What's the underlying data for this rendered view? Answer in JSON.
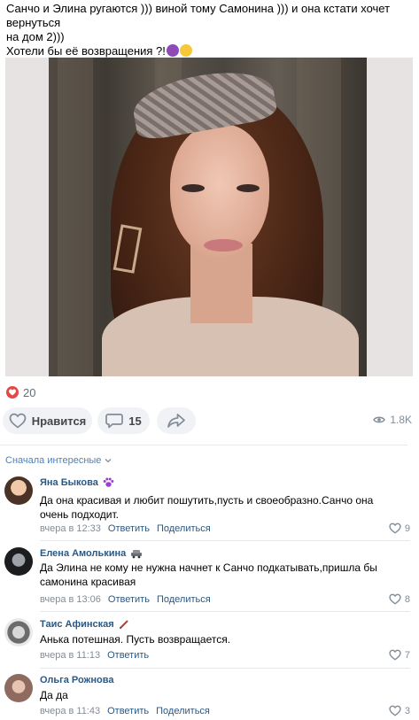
{
  "post": {
    "line1": "Санчо и Элина ругаются ))) виной тому Самонина ))) и она кстати хочет вернуться",
    "line2": "на дом 2)))",
    "line3": "Хотели бы её возвращения ?!",
    "emoji": [
      "purple-face-emoji",
      "yellow-face-emoji"
    ]
  },
  "reactions": {
    "likes": "20",
    "heart_color": "#e64646"
  },
  "actions": {
    "like_label": "Нравится",
    "comments_count": "15",
    "views": "1.8K"
  },
  "comments_section": {
    "sort_label": "Сначала интересные"
  },
  "comments": [
    {
      "name": "Яна Быкова",
      "badge": "paw-icon",
      "text": "Да она красивая и любит пошутить,пусть и своеобразно.Санчо она очень подходит.",
      "time": "вчера в 12:33",
      "reply": "Ответить",
      "share": "Поделиться",
      "likes": "9"
    },
    {
      "name": "Елена Амолькина",
      "badge": "car-icon",
      "text": "Да Элина не кому не нужна начнет к Санчо подкатывать,пришла бы самонина красивая",
      "time": "вчера в 13:06",
      "reply": "Ответить",
      "share": "Поделиться",
      "likes": "8"
    },
    {
      "name": "Таис Афинская",
      "badge": "pen-icon",
      "text": "Анька потешная. Пусть возвращается.",
      "time": "вчера в 11:13",
      "reply": "Ответить",
      "share": "",
      "likes": "7"
    },
    {
      "name": "Ольга Рожнова",
      "badge": "",
      "text": "Да да",
      "time": "вчера в 11:43",
      "reply": "Ответить",
      "share": "Поделиться",
      "likes": "3"
    }
  ],
  "colors": {
    "link": "#2a5885",
    "secondary": "#818c99",
    "button_bg": "#f0f2f5",
    "accent": "#5181b8"
  }
}
